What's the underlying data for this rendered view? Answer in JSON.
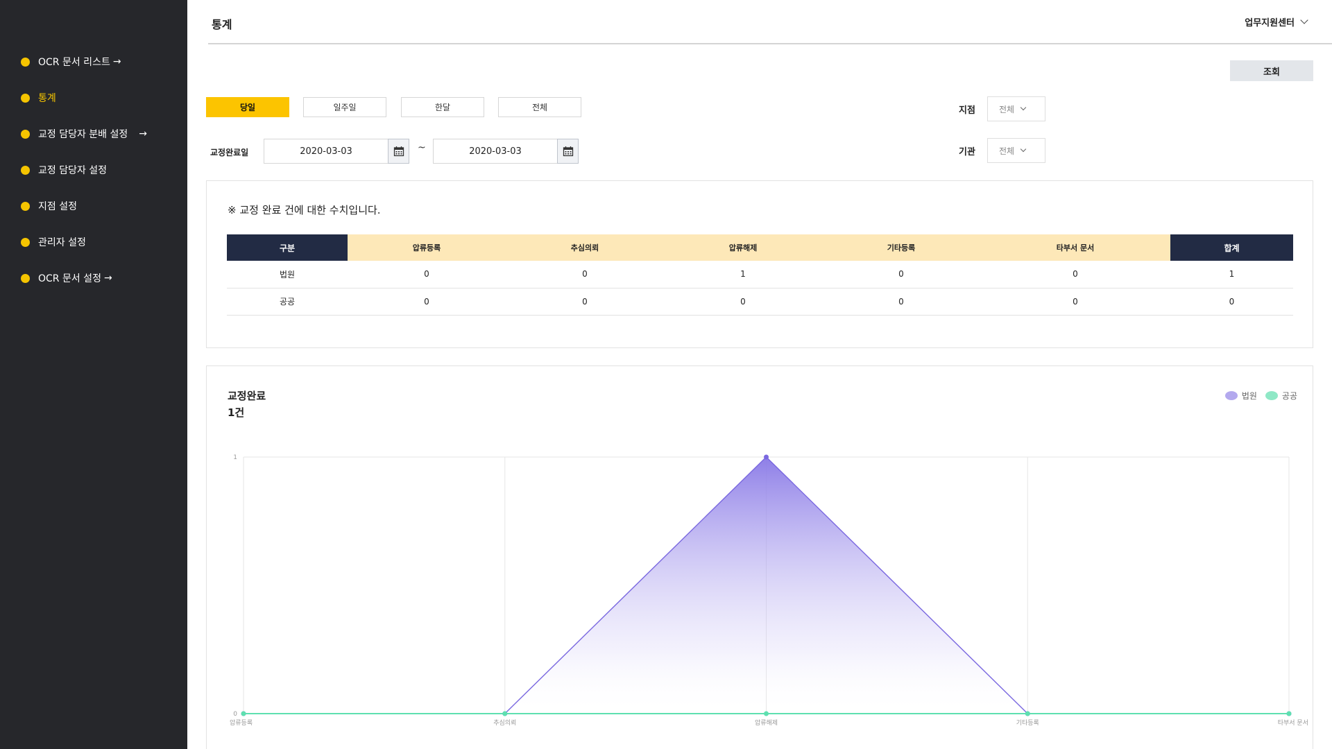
{
  "sidebar": {
    "items": [
      {
        "label": "OCR 문서 리스트",
        "arrow": "→",
        "active": false
      },
      {
        "label": "통계",
        "arrow": "",
        "active": true
      },
      {
        "label": "교정 담당자 분배 설정",
        "arrow": "→",
        "active": false
      },
      {
        "label": "교정 담당자 설정",
        "arrow": "",
        "active": false
      },
      {
        "label": "지점 설정",
        "arrow": "",
        "active": false
      },
      {
        "label": "관리자 설정",
        "arrow": "",
        "active": false
      },
      {
        "label": "OCR 문서 설정",
        "arrow": "→",
        "active": false
      }
    ]
  },
  "header": {
    "title": "통계",
    "user_menu": "업무지원센터"
  },
  "toolbar": {
    "search_label": "조회"
  },
  "period": {
    "options": [
      "당일",
      "일주일",
      "한달",
      "전체"
    ],
    "selected": "당일"
  },
  "filters": {
    "branch_label": "지점",
    "branch_value": "전체",
    "agency_label": "기관",
    "agency_value": "전체"
  },
  "date_range": {
    "label": "교정완료일",
    "from": "2020-03-03",
    "to": "2020-03-03",
    "separator": "~"
  },
  "summary": {
    "notice": "※ 교정 완료 건에 대한 수치입니다.",
    "columns": [
      "구분",
      "압류등록",
      "추심의뢰",
      "압류해제",
      "기타등록",
      "타부서 문서",
      "합계"
    ],
    "rows": [
      [
        "법원",
        "0",
        "0",
        "1",
        "0",
        "0",
        "1"
      ],
      [
        "공공",
        "0",
        "0",
        "0",
        "0",
        "0",
        "0"
      ]
    ]
  },
  "chart_section": {
    "title": "교정완료",
    "count": "1건"
  },
  "colors": {
    "accent": "#fcc400",
    "sidebar_bg": "#26272b",
    "table_header_dark": "#222b44",
    "table_header_light": "#fde8b8",
    "series_court": "#7a68e0",
    "series_public": "#5ee0b0"
  },
  "chart_data": {
    "type": "area",
    "categories": [
      "압류등록",
      "추심의뢰",
      "압류해제",
      "기타등록",
      "타부서 문서"
    ],
    "series": [
      {
        "name": "법원",
        "values": [
          0,
          0,
          1,
          0,
          0
        ],
        "color": "#7a68e0"
      },
      {
        "name": "공공",
        "values": [
          0,
          0,
          0,
          0,
          0
        ],
        "color": "#5ee0b0"
      }
    ],
    "title": "",
    "xlabel": "",
    "ylabel": "",
    "ylim": [
      0,
      1
    ],
    "yticks": [
      "0",
      "1"
    ],
    "grid": true,
    "legend": "top-right"
  }
}
